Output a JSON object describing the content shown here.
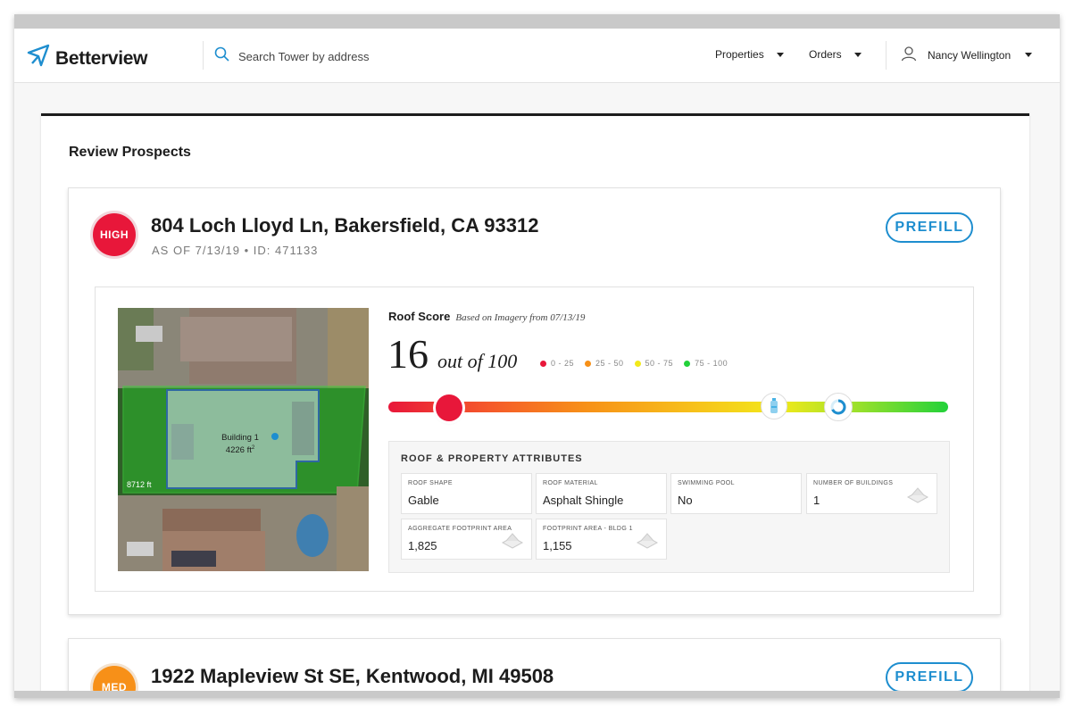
{
  "header": {
    "logo_text": "Betterview",
    "search_placeholder": "Search Tower by address",
    "nav": [
      {
        "label": "Properties"
      },
      {
        "label": "Orders"
      }
    ],
    "user_name": "Nancy Wellington"
  },
  "page": {
    "title": "Review Prospects"
  },
  "prospects": [
    {
      "risk_label": "HIGH",
      "address": "804 Loch Lloyd Ln, Bakersfield, CA 93312",
      "as_of": "AS OF 7/13/19 • ID: 471133",
      "prefill_label": "PREFILL",
      "aerial": {
        "building_label": "Building 1",
        "building_area": "4226 ft",
        "building_area_sup": "2",
        "parcel_area": "8712 ft"
      },
      "roof_score": {
        "title": "Roof Score",
        "subtitle": "Based on Imagery from 07/13/19",
        "value": "16",
        "out_of": "out of 100",
        "score_fraction": 0.16,
        "legend": [
          {
            "label": "0 - 25",
            "color": "#e8173a"
          },
          {
            "label": "25 - 50",
            "color": "#f79018"
          },
          {
            "label": "50 - 75",
            "color": "#f2e91a"
          },
          {
            "label": "75 - 100",
            "color": "#22d13a"
          }
        ]
      },
      "attributes": {
        "title": "ROOF & PROPERTY ATTRIBUTES",
        "items": [
          {
            "label": "ROOF SHAPE",
            "value": "Gable"
          },
          {
            "label": "ROOF MATERIAL",
            "value": "Asphalt Shingle"
          },
          {
            "label": "SWIMMING POOL",
            "value": "No"
          },
          {
            "label": "NUMBER OF BUILDINGS",
            "value": "1"
          },
          {
            "label": "AGGREGATE FOOTPRINT AREA",
            "value": "1,825"
          },
          {
            "label": "FOOTPRINT AREA - BLDG 1",
            "value": "1,155"
          }
        ]
      }
    },
    {
      "risk_label": "MED",
      "address": "1922 Mapleview St SE, Kentwood, MI 49508",
      "prefill_label": "PREFILL"
    }
  ],
  "colors": {
    "accent": "#1e8ecf",
    "high": "#e8173a",
    "med": "#f79018"
  }
}
